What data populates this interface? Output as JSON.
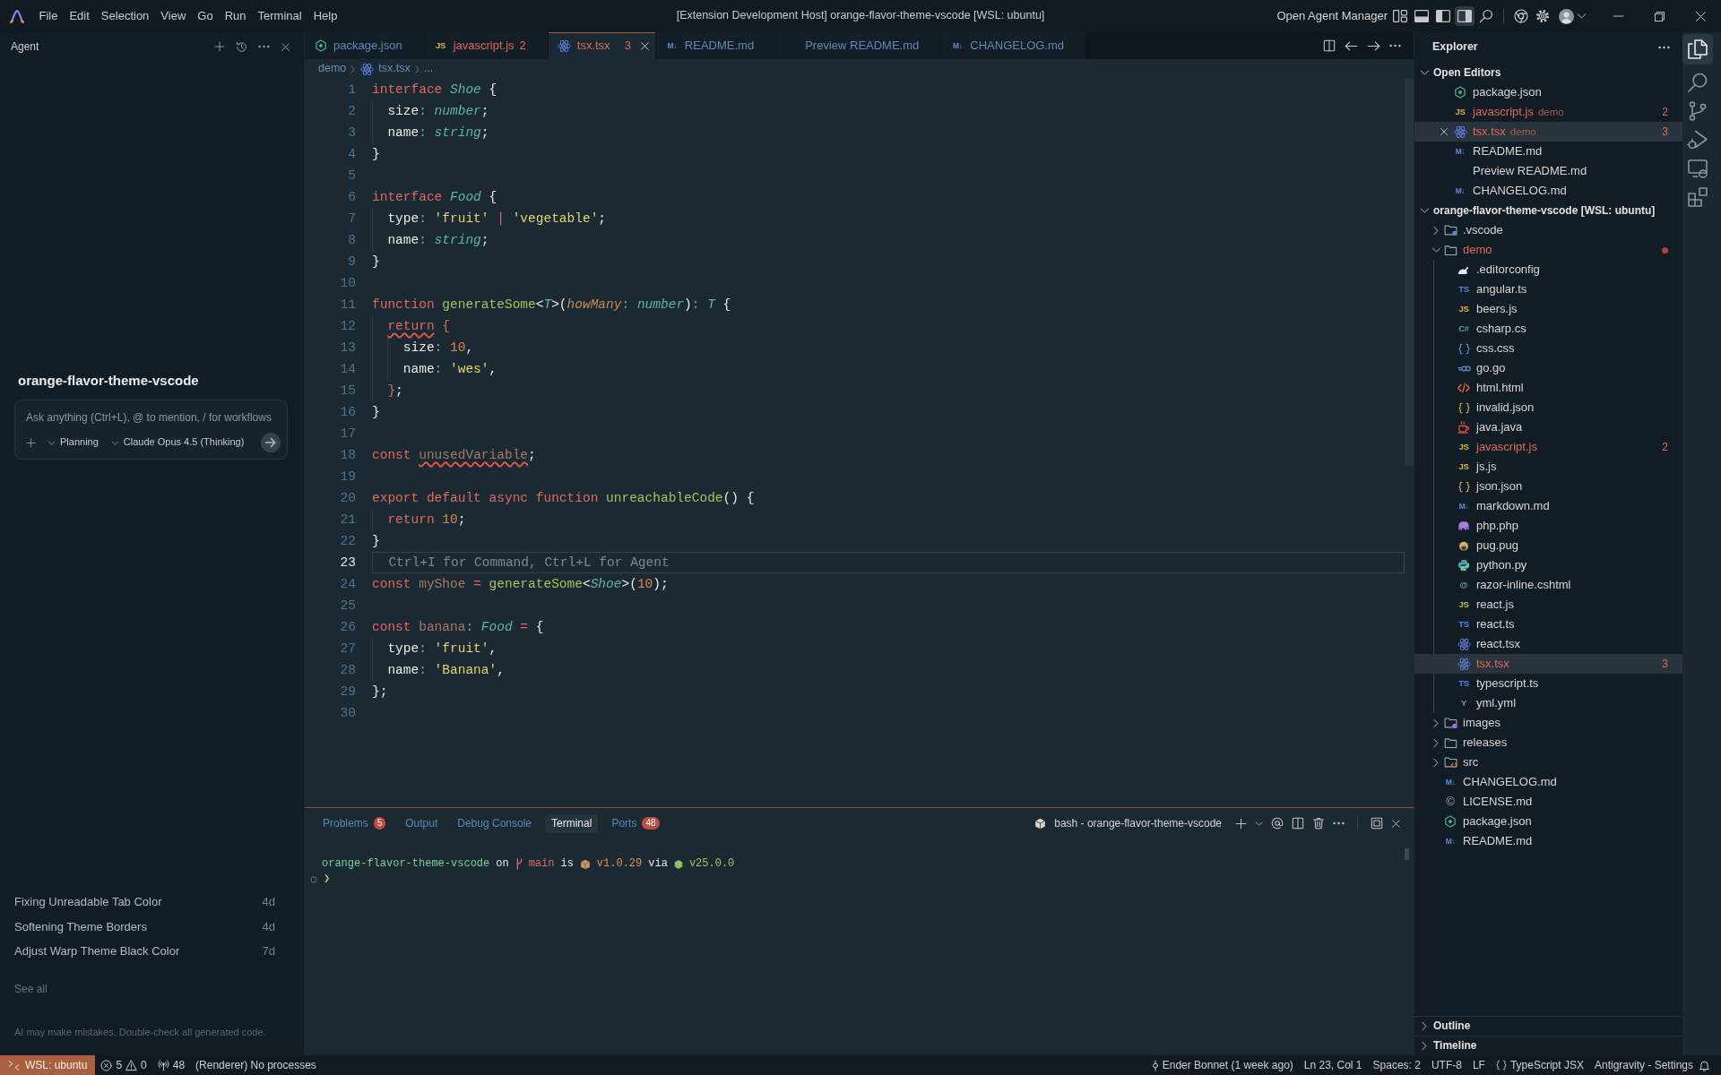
{
  "title_bar": {
    "menus": [
      "File",
      "Edit",
      "Selection",
      "View",
      "Go",
      "Run",
      "Terminal",
      "Help"
    ],
    "title": "[Extension Development Host] orange-flavor-theme-vscode [WSL: ubuntu]",
    "agent_manager": "Open Agent Manager",
    "layout_buttons": [
      {
        "kind": "customize",
        "active": false
      },
      {
        "kind": "panel",
        "active": false
      },
      {
        "kind": "primary",
        "active": false
      },
      {
        "kind": "secondary",
        "active": true
      }
    ]
  },
  "agent": {
    "title": "Agent",
    "workspace": "orange-flavor-theme-vscode",
    "composer": {
      "placeholder": "Ask anything (Ctrl+L), @ to mention, / for workflows",
      "mode": "Planning",
      "model": "Claude Opus 4.5 (Thinking)"
    },
    "recent": [
      {
        "title": "Fixing Unreadable Tab Color",
        "age": "4d"
      },
      {
        "title": "Softening Theme Borders",
        "age": "4d"
      },
      {
        "title": "Adjust Warp Theme Black Color",
        "age": "7d"
      }
    ],
    "see_all": "See all",
    "disclaimer": "AI may make mistakes. Double-check all generated code."
  },
  "editor": {
    "tabs": [
      {
        "label": "package.json",
        "kind": "node",
        "selected": false,
        "error": false
      },
      {
        "label": "javascript.js",
        "kind": "js",
        "glyph": "JS",
        "problems": "2",
        "selected": false,
        "error": true
      },
      {
        "label": "tsx.tsx",
        "kind": "react",
        "problems": "3",
        "selected": true,
        "error": true
      },
      {
        "label": "README.md",
        "kind": "markdown",
        "glyph": "M↓",
        "selected": false,
        "error": false
      },
      {
        "label": "Preview README.md",
        "selected": false,
        "error": false
      },
      {
        "label": "CHANGELOG.md",
        "kind": "markdown",
        "glyph": "M↓",
        "selected": false,
        "error": false
      }
    ],
    "breadcrumb": {
      "folder": "demo",
      "file": {
        "label": "tsx.tsx",
        "kind": "react"
      },
      "symbol": "..."
    },
    "lines": [
      {
        "number": "1",
        "current": false,
        "tokens": [
          {
            "kind": "keyword",
            "text": "interface "
          },
          {
            "kind": "type",
            "text": "Shoe"
          },
          {
            "kind": "plain",
            "text": " {"
          }
        ]
      },
      {
        "number": "2",
        "current": false,
        "tokens": [
          {
            "kind": "property",
            "text": "  size"
          },
          {
            "kind": "punct",
            "text": ": "
          },
          {
            "kind": "type",
            "text": "number"
          },
          {
            "kind": "plain",
            "text": ";"
          }
        ]
      },
      {
        "number": "3",
        "current": false,
        "tokens": [
          {
            "kind": "property",
            "text": "  name"
          },
          {
            "kind": "punct",
            "text": ": "
          },
          {
            "kind": "type",
            "text": "string"
          },
          {
            "kind": "plain",
            "text": ";"
          }
        ]
      },
      {
        "number": "4",
        "current": false,
        "tokens": [
          {
            "kind": "plain",
            "text": "}"
          }
        ]
      },
      {
        "number": "5",
        "current": false
      },
      {
        "number": "6",
        "current": false,
        "tokens": [
          {
            "kind": "keyword",
            "text": "interface "
          },
          {
            "kind": "type",
            "text": "Food"
          },
          {
            "kind": "plain",
            "text": " {"
          }
        ]
      },
      {
        "number": "7",
        "current": false,
        "tokens": [
          {
            "kind": "property",
            "text": "  type"
          },
          {
            "kind": "punct",
            "text": ": "
          },
          {
            "kind": "string",
            "text": "'fruit'"
          },
          {
            "kind": "operator",
            "text": " | "
          },
          {
            "kind": "string",
            "text": "'vegetable'"
          },
          {
            "kind": "plain",
            "text": ";"
          }
        ]
      },
      {
        "number": "8",
        "current": false,
        "tokens": [
          {
            "kind": "property",
            "text": "  name"
          },
          {
            "kind": "punct",
            "text": ": "
          },
          {
            "kind": "type",
            "text": "string"
          },
          {
            "kind": "plain",
            "text": ";"
          }
        ]
      },
      {
        "number": "9",
        "current": false,
        "tokens": [
          {
            "kind": "plain",
            "text": "}"
          }
        ]
      },
      {
        "number": "10",
        "current": false
      },
      {
        "number": "11",
        "current": false,
        "tokens": [
          {
            "kind": "keyword",
            "text": "function "
          },
          {
            "kind": "function",
            "text": "generateSome"
          },
          {
            "kind": "plain",
            "text": "<"
          },
          {
            "kind": "type",
            "text": "T"
          },
          {
            "kind": "plain",
            "text": ">("
          },
          {
            "kind": "param",
            "text": "howMany"
          },
          {
            "kind": "punct",
            "text": ": "
          },
          {
            "kind": "type",
            "text": "number"
          },
          {
            "kind": "plain",
            "text": ")"
          },
          {
            "kind": "punct",
            "text": ": "
          },
          {
            "kind": "type",
            "text": "T"
          },
          {
            "kind": "plain",
            "text": " {"
          }
        ]
      },
      {
        "number": "12",
        "current": false,
        "tokens": [
          {
            "kind": "keyword",
            "text": "  return",
            "error": true
          },
          {
            "kind": "bracket",
            "text": " {",
            "error": false
          }
        ]
      },
      {
        "number": "13",
        "current": false,
        "tokens": [
          {
            "kind": "property",
            "text": "    size"
          },
          {
            "kind": "punct",
            "text": ": "
          },
          {
            "kind": "number",
            "text": "10"
          },
          {
            "kind": "plain",
            "text": ","
          }
        ]
      },
      {
        "number": "14",
        "current": false,
        "tokens": [
          {
            "kind": "property",
            "text": "    name"
          },
          {
            "kind": "punct",
            "text": ": "
          },
          {
            "kind": "string",
            "text": "'wes'"
          },
          {
            "kind": "plain",
            "text": ","
          }
        ]
      },
      {
        "number": "15",
        "current": false,
        "tokens": [
          {
            "kind": "bracket",
            "text": "  }"
          },
          {
            "kind": "plain",
            "text": ";"
          }
        ]
      },
      {
        "number": "16",
        "current": false,
        "tokens": [
          {
            "kind": "plain",
            "text": "}"
          }
        ]
      },
      {
        "number": "17",
        "current": false
      },
      {
        "number": "18",
        "current": false,
        "tokens": [
          {
            "kind": "keyword",
            "text": "const ",
            "error": false
          },
          {
            "kind": "variable",
            "text": "unusedVariable",
            "error": true
          },
          {
            "kind": "plain",
            "text": ";",
            "error": false
          }
        ]
      },
      {
        "number": "19",
        "current": false
      },
      {
        "number": "20",
        "current": false,
        "tokens": [
          {
            "kind": "keyword",
            "text": "export default async function "
          },
          {
            "kind": "function",
            "text": "unreachableCode"
          },
          {
            "kind": "plain",
            "text": "() {"
          }
        ]
      },
      {
        "number": "21",
        "current": false,
        "tokens": [
          {
            "kind": "keyword",
            "text": "  return "
          },
          {
            "kind": "number",
            "text": "10"
          },
          {
            "kind": "plain",
            "text": ";"
          }
        ]
      },
      {
        "number": "22",
        "current": false,
        "tokens": [
          {
            "kind": "plain",
            "text": "}"
          }
        ]
      },
      {
        "number": "23",
        "current": true,
        "hint": "Ctrl+I for Command, Ctrl+L for Agent"
      },
      {
        "number": "24",
        "current": false,
        "tokens": [
          {
            "kind": "keyword",
            "text": "const "
          },
          {
            "kind": "variable",
            "text": "myShoe"
          },
          {
            "kind": "operator",
            "text": " = "
          },
          {
            "kind": "function",
            "text": "generateSome"
          },
          {
            "kind": "plain",
            "text": "<"
          },
          {
            "kind": "type",
            "text": "Shoe"
          },
          {
            "kind": "plain",
            "text": ">("
          },
          {
            "kind": "number",
            "text": "10"
          },
          {
            "kind": "plain",
            "text": ");"
          }
        ]
      },
      {
        "number": "25",
        "current": false
      },
      {
        "number": "26",
        "current": false,
        "tokens": [
          {
            "kind": "keyword",
            "text": "const "
          },
          {
            "kind": "variable",
            "text": "banana"
          },
          {
            "kind": "punct",
            "text": ": "
          },
          {
            "kind": "type",
            "text": "Food"
          },
          {
            "kind": "operator",
            "text": " = "
          },
          {
            "kind": "plain",
            "text": "{"
          }
        ]
      },
      {
        "number": "27",
        "current": false,
        "tokens": [
          {
            "kind": "property",
            "text": "  type"
          },
          {
            "kind": "punct",
            "text": ": "
          },
          {
            "kind": "string",
            "text": "'fruit'"
          },
          {
            "kind": "plain",
            "text": ","
          }
        ]
      },
      {
        "number": "28",
        "current": false,
        "tokens": [
          {
            "kind": "property",
            "text": "  name"
          },
          {
            "kind": "punct",
            "text": ": "
          },
          {
            "kind": "string",
            "text": "'Banana'"
          },
          {
            "kind": "plain",
            "text": ","
          }
        ]
      },
      {
        "number": "29",
        "current": false,
        "tokens": [
          {
            "kind": "plain",
            "text": "};"
          }
        ]
      },
      {
        "number": "30",
        "current": false
      }
    ]
  },
  "panel": {
    "tabs": [
      {
        "label": "Problems",
        "badge": "5",
        "selected": false
      },
      {
        "label": "Output",
        "selected": false
      },
      {
        "label": "Debug Console",
        "selected": false
      },
      {
        "label": "Terminal",
        "selected": true
      },
      {
        "label": "Ports",
        "badge": "48",
        "selected": false
      }
    ],
    "shell": "bash - orange-flavor-theme-vscode",
    "prompt": {
      "directory": "orange-flavor-theme-vscode",
      "on": "on",
      "branch": "main",
      "is": "is",
      "package_version": "v1.0.29",
      "via": "via",
      "node_version": "v25.0.0",
      "symbol": "❯"
    }
  },
  "explorer": {
    "title": "Explorer",
    "open_editors": {
      "title": "Open Editors",
      "expanded": true,
      "items": [
        {
          "name": "package.json",
          "kind": "node",
          "selected": false,
          "error": false
        },
        {
          "name": "javascript.js",
          "kind": "js",
          "glyph": "JS",
          "description": "demo",
          "problems": "2",
          "selected": false,
          "error": true
        },
        {
          "name": "tsx.tsx",
          "kind": "react",
          "description": "demo",
          "problems": "3",
          "selected": true,
          "error": true
        },
        {
          "name": "README.md",
          "kind": "markdown",
          "glyph": "M↓",
          "selected": false,
          "error": false
        },
        {
          "name": "Preview README.md",
          "selected": false,
          "error": false
        },
        {
          "name": "CHANGELOG.md",
          "kind": "markdown",
          "glyph": "M↓",
          "selected": false,
          "error": false
        }
      ]
    },
    "folder": {
      "title": "orange-flavor-theme-vscode [WSL: ubuntu]",
      "expanded": true,
      "children": [
        {
          "name": ".vscode",
          "kind": "configfolder",
          "expanded": false,
          "selected": false,
          "error": false
        },
        {
          "name": "demo",
          "kind": "folder",
          "expanded": true,
          "selected": false,
          "error": true,
          "children": [
            {
              "name": ".editorconfig",
              "kind": "editorconfig",
              "selected": false,
              "error": false
            },
            {
              "name": "angular.ts",
              "kind": "ts",
              "glyph": "TS",
              "selected": false,
              "error": false
            },
            {
              "name": "beers.js",
              "kind": "js",
              "glyph": "JS",
              "selected": false,
              "error": false
            },
            {
              "name": "csharp.cs",
              "kind": "csharp",
              "glyph": "C#",
              "selected": false,
              "error": false
            },
            {
              "name": "css.css",
              "kind": "css",
              "selected": false,
              "error": false
            },
            {
              "name": "go.go",
              "kind": "go",
              "selected": false,
              "error": false
            },
            {
              "name": "html.html",
              "kind": "html",
              "selected": false,
              "error": false
            },
            {
              "name": "invalid.json",
              "kind": "json",
              "selected": false,
              "error": false
            },
            {
              "name": "java.java",
              "kind": "java",
              "selected": false,
              "error": false
            },
            {
              "name": "javascript.js",
              "kind": "js",
              "glyph": "JS",
              "problems": "2",
              "selected": false,
              "error": true
            },
            {
              "name": "js.js",
              "kind": "js",
              "glyph": "JS",
              "selected": false,
              "error": false
            },
            {
              "name": "json.json",
              "kind": "json",
              "selected": false,
              "error": false
            },
            {
              "name": "markdown.md",
              "kind": "markdown",
              "glyph": "M↓",
              "selected": false,
              "error": false
            },
            {
              "name": "php.php",
              "kind": "php",
              "selected": false,
              "error": false
            },
            {
              "name": "pug.pug",
              "kind": "pug",
              "selected": false,
              "error": false
            },
            {
              "name": "python.py",
              "kind": "python",
              "selected": false,
              "error": false
            },
            {
              "name": "razor-inline.cshtml",
              "kind": "razor",
              "glyph": "@",
              "selected": false,
              "error": false
            },
            {
              "name": "react.js",
              "kind": "js",
              "glyph": "JS",
              "selected": false,
              "error": false
            },
            {
              "name": "react.ts",
              "kind": "ts",
              "glyph": "TS",
              "selected": false,
              "error": false
            },
            {
              "name": "react.tsx",
              "kind": "react",
              "selected": false,
              "error": false
            },
            {
              "name": "tsx.tsx",
              "kind": "react",
              "problems": "3",
              "selected": true,
              "error": true
            },
            {
              "name": "typescript.ts",
              "kind": "ts",
              "glyph": "TS",
              "selected": false,
              "error": false
            },
            {
              "name": "yml.yml",
              "kind": "yml",
              "glyph": "Y",
              "selected": false,
              "error": false
            }
          ]
        },
        {
          "name": "images",
          "kind": "imagefolder",
          "expanded": false,
          "selected": false,
          "error": false
        },
        {
          "name": "releases",
          "kind": "folder",
          "expanded": false,
          "selected": false,
          "error": false
        },
        {
          "name": "src",
          "kind": "codefolder",
          "expanded": false,
          "selected": false,
          "error": false
        },
        {
          "name": "CHANGELOG.md",
          "kind": "markdown",
          "glyph": "M↓",
          "selected": false,
          "error": false
        },
        {
          "name": "LICENSE.md",
          "kind": "license",
          "glyph": "©",
          "selected": false,
          "error": false
        },
        {
          "name": "package.json",
          "kind": "node",
          "selected": false,
          "error": false
        },
        {
          "name": "README.md",
          "kind": "markdown",
          "glyph": "M↓",
          "selected": false,
          "error": false
        }
      ]
    },
    "sections": [
      {
        "title": "Outline",
        "expanded": false
      },
      {
        "title": "Timeline",
        "expanded": false
      }
    ]
  },
  "activity_bar": [
    {
      "kind": "explorer",
      "selected": true
    },
    {
      "kind": "search",
      "selected": false
    },
    {
      "kind": "scm",
      "selected": false
    },
    {
      "kind": "debug",
      "selected": false
    },
    {
      "kind": "remote",
      "selected": false
    },
    {
      "kind": "extensions",
      "selected": false
    }
  ],
  "status_bar": {
    "remote": "WSL: ubuntu",
    "errors": "5",
    "warnings": "0",
    "ports": "48",
    "renderer": "(Renderer) No processes",
    "items": [
      {
        "kind": "blame",
        "text": "Ender Bonnet (1 week ago)"
      },
      {
        "kind": "plain",
        "text": "Ln 23, Col 1"
      },
      {
        "kind": "plain",
        "text": "Spaces: 2"
      },
      {
        "kind": "plain",
        "text": "UTF-8"
      },
      {
        "kind": "plain",
        "text": "LF"
      },
      {
        "kind": "language",
        "text": "TypeScript JSX"
      },
      {
        "kind": "plain",
        "text": "Antigravity - Settings"
      }
    ]
  }
}
